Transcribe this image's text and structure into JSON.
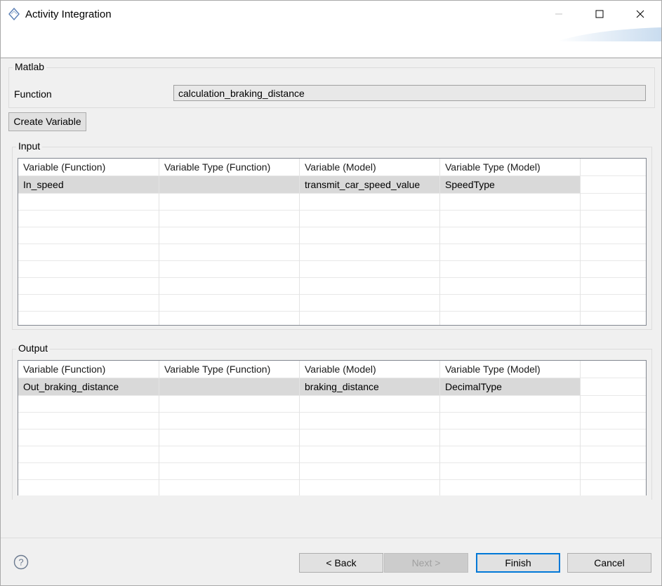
{
  "window": {
    "title": "Activity Integration",
    "icons": {
      "app": "activity-diamond-icon",
      "minimize": "minimize-icon",
      "maximize": "maximize-icon",
      "close": "close-icon"
    }
  },
  "matlab": {
    "group_title": "Matlab",
    "function_label": "Function",
    "function_value": "calculation_braking_distance"
  },
  "create_variable_label": "Create Variable",
  "input": {
    "title": "Input",
    "columns": [
      "Variable (Function)",
      "Variable Type (Function)",
      "Variable (Model)",
      "Variable Type (Model)"
    ],
    "rows": [
      {
        "var_function": "In_speed",
        "type_function": "",
        "var_model": "transmit_car_speed_value",
        "type_model": "SpeedType"
      }
    ]
  },
  "output": {
    "title": "Output",
    "columns": [
      "Variable (Function)",
      "Variable Type (Function)",
      "Variable (Model)",
      "Variable Type (Model)"
    ],
    "rows": [
      {
        "var_function": "Out_braking_distance",
        "type_function": "",
        "var_model": "braking_distance",
        "type_model": "DecimalType"
      }
    ]
  },
  "footer": {
    "help_icon": "help-question-icon",
    "back": "< Back",
    "next": "Next >",
    "finish": "Finish",
    "cancel": "Cancel"
  },
  "colors": {
    "accent": "#0078d7",
    "selection": "#d9d9d9"
  }
}
